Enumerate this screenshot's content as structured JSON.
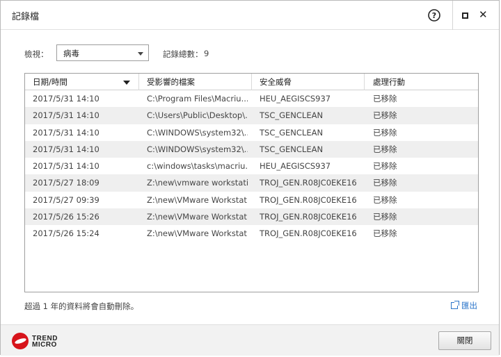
{
  "window": {
    "title": "記錄檔"
  },
  "filter": {
    "label": "檢視：",
    "selected": "病毒"
  },
  "count": {
    "label": "記錄總數：",
    "value": "9"
  },
  "table": {
    "columns": [
      "日期/時間",
      "受影響的檔案",
      "安全威脅",
      "處理行動"
    ],
    "rows": [
      [
        "2017/5/31 14:10",
        "C:\\Program Files\\Macriu...",
        "HEU_AEGISCS937",
        "已移除"
      ],
      [
        "2017/5/31 14:10",
        "C:\\Users\\Public\\Desktop\\...",
        "TSC_GENCLEAN",
        "已移除"
      ],
      [
        "2017/5/31 14:10",
        "C:\\WINDOWS\\system32\\...",
        "TSC_GENCLEAN",
        "已移除"
      ],
      [
        "2017/5/31 14:10",
        "C:\\WINDOWS\\system32\\...",
        "TSC_GENCLEAN",
        "已移除"
      ],
      [
        "2017/5/31 14:10",
        "c:\\windows\\tasks\\macriu...",
        "HEU_AEGISCS937",
        "已移除"
      ],
      [
        "2017/5/27 18:09",
        "Z:\\new\\vmware workstati...",
        "TROJ_GEN.R08JC0EKE16",
        "已移除"
      ],
      [
        "2017/5/27 09:39",
        "Z:\\new\\VMware Workstat...",
        "TROJ_GEN.R08JC0EKE16",
        "已移除"
      ],
      [
        "2017/5/26 15:26",
        "Z:\\new\\VMware Workstat...",
        "TROJ_GEN.R08JC0EKE16",
        "已移除"
      ],
      [
        "2017/5/26 15:24",
        "Z:\\new\\VMware Workstat...",
        "TROJ_GEN.R08JC0EKE16",
        "已移除"
      ]
    ]
  },
  "footer_note": "超過 1 年的資料將會自動刪除。",
  "export_label": "匯出",
  "brand": {
    "line1": "TREND",
    "line2": "MICRO"
  },
  "close_button": "關閉",
  "colors": {
    "accent": "#2a74c9",
    "brand_red": "#d7141b"
  }
}
